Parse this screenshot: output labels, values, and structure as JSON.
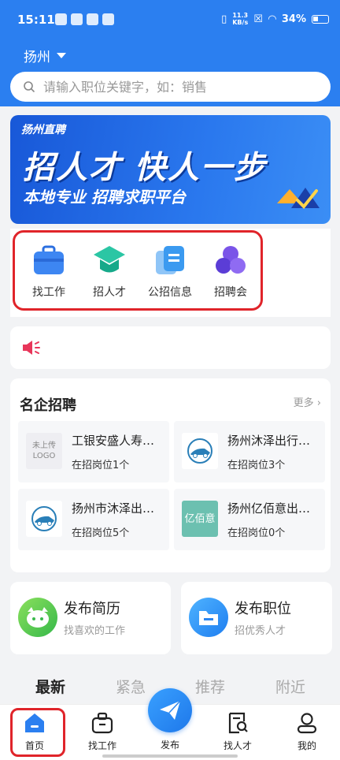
{
  "status": {
    "time": "15:11",
    "speed_value": "11.3",
    "speed_unit": "KB/s",
    "battery": "34%"
  },
  "header": {
    "city": "扬州",
    "search_placeholder": "请输入职位关键字，如：销售"
  },
  "banner": {
    "brand": "扬州直聘",
    "headline": "招人才 快人一步",
    "subline": "本地专业 招聘求职平台"
  },
  "quick_nav": [
    {
      "label": "找工作",
      "icon": "briefcase-icon"
    },
    {
      "label": "招人才",
      "icon": "graduation-cap-icon"
    },
    {
      "label": "公招信息",
      "icon": "document-icon"
    },
    {
      "label": "招聘会",
      "icon": "people-group-icon"
    }
  ],
  "notice": {
    "icon": "speaker-icon"
  },
  "famous": {
    "title": "名企招聘",
    "more": "更多",
    "companies": [
      {
        "name": "工银安盛人寿…",
        "positions": "在招岗位1个",
        "logo_text": "未上传\nLOGO"
      },
      {
        "name": "扬州沐泽出行…",
        "positions": "在招岗位3个",
        "logo_text": ""
      },
      {
        "name": "扬州市沐泽出…",
        "positions": "在招岗位5个",
        "logo_text": ""
      },
      {
        "name": "扬州亿佰意出…",
        "positions": "在招岗位0个",
        "logo_text": "亿佰意"
      }
    ]
  },
  "publish": {
    "resume": {
      "title": "发布简历",
      "subtitle": "找喜欢的工作"
    },
    "job": {
      "title": "发布职位",
      "subtitle": "招优秀人才"
    }
  },
  "tabs": [
    "最新",
    "紧急",
    "推荐",
    "附近"
  ],
  "bottom_nav": [
    {
      "label": "首页",
      "icon": "home-icon"
    },
    {
      "label": "找工作",
      "icon": "briefcase-icon"
    },
    {
      "label": "发布",
      "icon": "paper-plane-icon"
    },
    {
      "label": "找人才",
      "icon": "search-document-icon"
    },
    {
      "label": "我的",
      "icon": "user-icon"
    }
  ],
  "colors": {
    "primary": "#2b7ff0",
    "highlight_outline": "#e0242a",
    "notice_icon": "#e8365a"
  }
}
